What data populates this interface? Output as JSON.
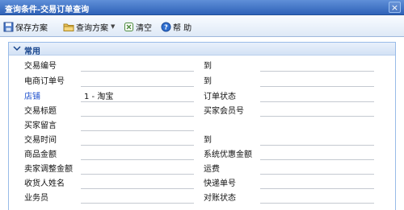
{
  "window": {
    "title": "查询条件-交易订单查询",
    "close_glyph": "×"
  },
  "toolbar": {
    "save_scheme": "保存方案",
    "query_scheme": "查询方案",
    "clear": "清空",
    "help": "帮 助"
  },
  "panel": {
    "title": "常用"
  },
  "fields": {
    "trade_no": "交易编号",
    "trade_no_to": "到",
    "ecom_order_no": "电商订单号",
    "ecom_order_no_to": "到",
    "shop": "店铺",
    "shop_value": "1 - 淘宝",
    "order_status": "订单状态",
    "trade_title": "交易标题",
    "buyer_member_no": "买家会员号",
    "buyer_message": "买家留言",
    "trade_time": "交易时间",
    "trade_time_to": "到",
    "goods_amount": "商品金额",
    "system_discount": "系统优惠金额",
    "seller_adjust": "卖家调整金额",
    "shipping_fee": "运费",
    "receiver_name": "收货人姓名",
    "express_no": "快递单号",
    "salesman": "业务员",
    "reconcile_status": "对账状态"
  },
  "colors": {
    "shop_label": "#1b4ecc",
    "title_bar": "#3d6fc4"
  }
}
